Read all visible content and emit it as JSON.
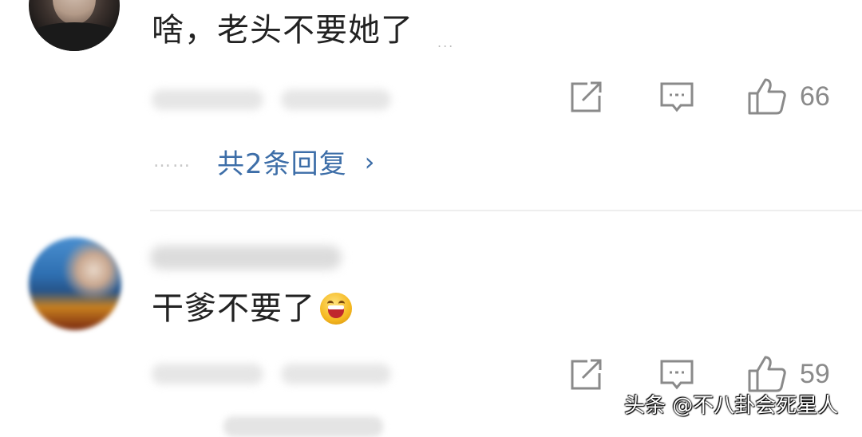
{
  "comments": [
    {
      "text": "啥，老头不要她了",
      "tail": "...",
      "likes": "66",
      "replies_label": "共2条回复",
      "replies_dots": "……",
      "replies_chevron": "›"
    },
    {
      "text": "干爹不要了",
      "likes": "59"
    }
  ],
  "watermark": "头条 @不八卦会死星人",
  "colors": {
    "link_blue": "#3d6ea8",
    "icon_gray": "#8a8a8a",
    "divider": "#eeeeee"
  },
  "icons": {
    "share": "share-icon",
    "comment": "comment-icon",
    "like": "thumbs-up-icon",
    "emoji": "laughing-emoji-icon"
  }
}
